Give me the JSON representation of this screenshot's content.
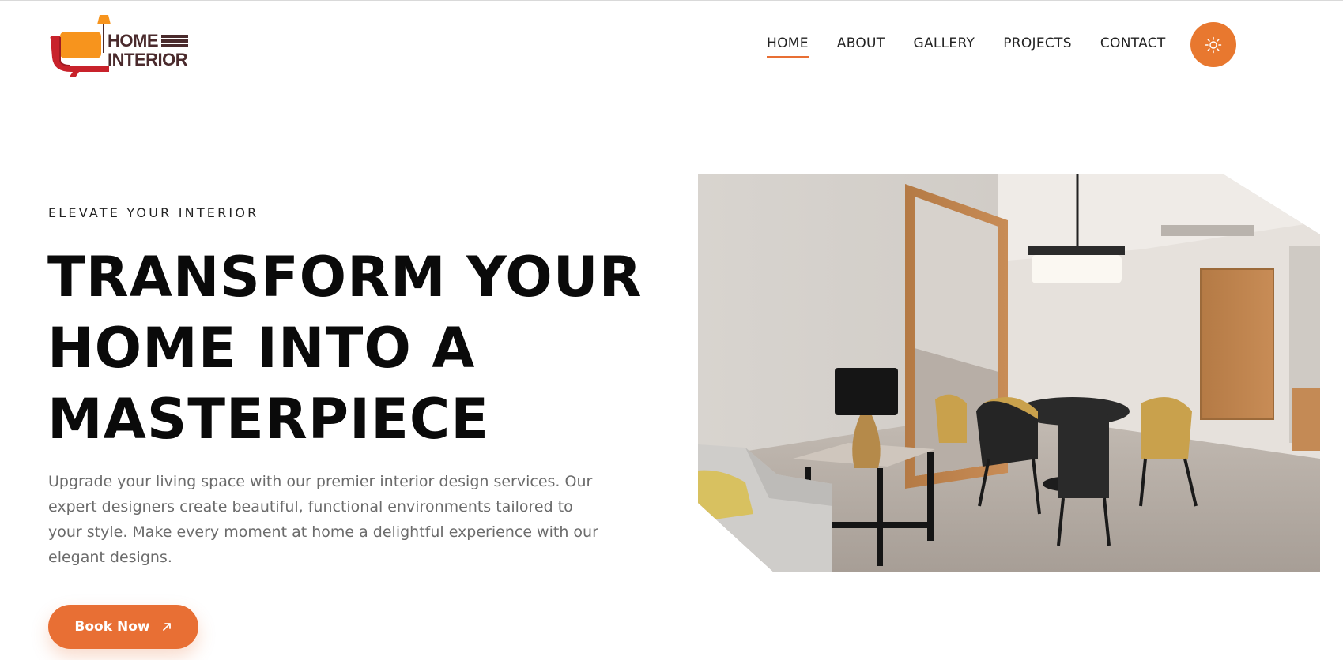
{
  "brand": {
    "line1": "HOME",
    "line2": "INTERIOR",
    "colors": {
      "sofa_orange": "#f7941d",
      "sofa_red": "#c8222b",
      "text": "#4a2a2c"
    }
  },
  "nav": {
    "items": [
      {
        "label": "HOME",
        "active": true
      },
      {
        "label": "ABOUT",
        "active": false
      },
      {
        "label": "GALLERY",
        "active": false
      },
      {
        "label": "PROJECTS",
        "active": false
      },
      {
        "label": "CONTACT",
        "active": false
      }
    ],
    "theme_toggle_icon": "sun-icon"
  },
  "hero": {
    "eyebrow": "ELEVATE YOUR INTERIOR",
    "headline_lines": [
      "TRANSFORM YOUR",
      "HOME INTO A",
      "MASTERPIECE"
    ],
    "description": "Upgrade your living space with our premier interior design services. Our expert designers create beautiful, functional environments tailored to your style. Make every moment at home a delightful experience with our elegant designs.",
    "cta": {
      "label": "Book Now",
      "icon": "arrow-up-right-icon"
    },
    "image": {
      "subject": "dining-room-photo"
    }
  },
  "colors": {
    "accent": "#e86f34",
    "heading": "#0a0a0a",
    "body_text": "#6b6b6b"
  }
}
